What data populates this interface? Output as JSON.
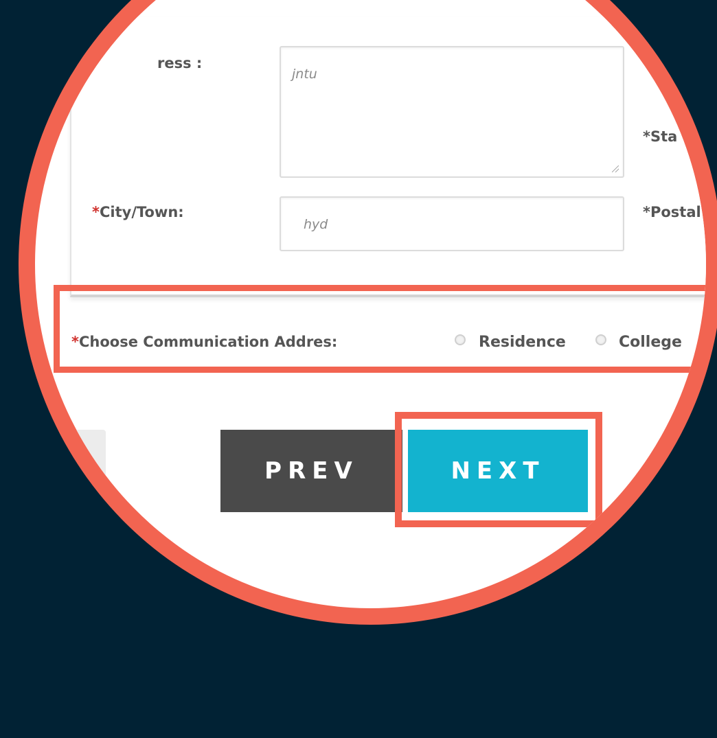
{
  "form": {
    "address_label": "ress :",
    "address_value": "jntu",
    "state_label": "*Sta",
    "city_label_mark": "*",
    "city_label": "City/Town:",
    "city_value": "hyd",
    "postal_label": "*Postal"
  },
  "communication": {
    "required_mark": "*",
    "label": "Choose Communication Addres:",
    "options": [
      "Residence",
      "College"
    ]
  },
  "buttons": {
    "prev": "PREV",
    "next": "NEXT"
  },
  "colors": {
    "background": "#012234",
    "highlight": "#f26451",
    "accent": "#13b3cf",
    "prev_button": "#4a4a4a"
  }
}
